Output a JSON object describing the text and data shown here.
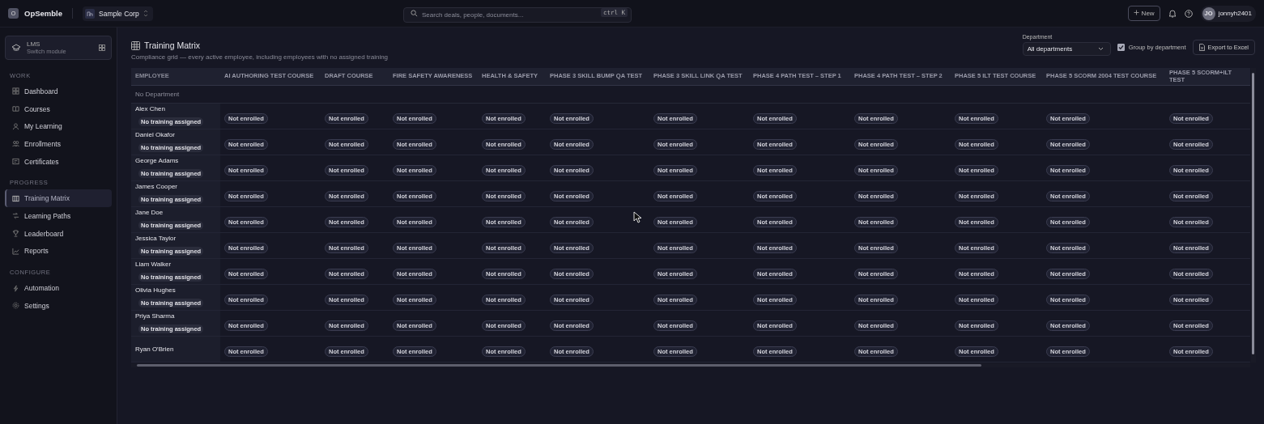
{
  "topbar": {
    "logo_letter": "O",
    "brand": "OpSemble",
    "org": "Sample Corp",
    "search": {
      "placeholder": "Search deals, people, documents...",
      "shortcut": "ctrl K"
    },
    "new_button": "New",
    "user": {
      "initials": "JO",
      "name": "jonnyh2401"
    }
  },
  "sidebar": {
    "module": {
      "name": "LMS",
      "subtitle": "Switch module"
    },
    "sections": [
      {
        "heading": "WORK",
        "items": [
          {
            "label": "Dashboard",
            "selected": false
          },
          {
            "label": "Courses",
            "selected": false
          },
          {
            "label": "My Learning",
            "selected": false
          },
          {
            "label": "Enrollments",
            "selected": false
          },
          {
            "label": "Certificates",
            "selected": false
          }
        ]
      },
      {
        "heading": "PROGRESS",
        "items": [
          {
            "label": "Training Matrix",
            "selected": true
          },
          {
            "label": "Learning Paths",
            "selected": false
          },
          {
            "label": "Leaderboard",
            "selected": false
          },
          {
            "label": "Reports",
            "selected": false
          }
        ]
      },
      {
        "heading": "CONFIGURE",
        "items": [
          {
            "label": "Automation",
            "selected": false
          },
          {
            "label": "Settings",
            "selected": false
          }
        ]
      }
    ]
  },
  "page": {
    "title": "Training Matrix",
    "subtitle": "Compliance grid — every active employee, including employees with no assigned training",
    "department": {
      "label": "Department",
      "value": "All departments"
    },
    "group_by": {
      "label": "Group by department",
      "checked": true
    },
    "export_button": "Export to Excel"
  },
  "table": {
    "columns": [
      "EMPLOYEE",
      "AI AUTHORING TEST COURSE",
      "DRAFT COURSE",
      "FIRE SAFETY AWARENESS",
      "HEALTH & SAFETY",
      "PHASE 3 SKILL BUMP QA TEST",
      "PHASE 3 SKILL LINK QA TEST",
      "PHASE 4 PATH TEST – STEP 1",
      "PHASE 4 PATH TEST – STEP 2",
      "PHASE 5 ILT TEST COURSE",
      "PHASE 5 SCORM 2004 TEST COURSE",
      "PHASE 5 SCORM+ILT TEST"
    ],
    "groups": [
      {
        "name": "No Department",
        "rows": [
          {
            "employee": "Alex Chen",
            "badge": "No training assigned",
            "cells": [
              "Not enrolled",
              "Not enrolled",
              "Not enrolled",
              "Not enrolled",
              "Not enrolled",
              "Not enrolled",
              "Not enrolled",
              "Not enrolled",
              "Not enrolled",
              "Not enrolled",
              "Not enrolled"
            ]
          },
          {
            "employee": "Daniel Okafor",
            "badge": "No training assigned",
            "cells": [
              "Not enrolled",
              "Not enrolled",
              "Not enrolled",
              "Not enrolled",
              "Not enrolled",
              "Not enrolled",
              "Not enrolled",
              "Not enrolled",
              "Not enrolled",
              "Not enrolled",
              "Not enrolled"
            ]
          },
          {
            "employee": "George Adams",
            "badge": "No training assigned",
            "cells": [
              "Not enrolled",
              "Not enrolled",
              "Not enrolled",
              "Not enrolled",
              "Not enrolled",
              "Not enrolled",
              "Not enrolled",
              "Not enrolled",
              "Not enrolled",
              "Not enrolled",
              "Not enrolled"
            ]
          },
          {
            "employee": "James Cooper",
            "badge": "No training assigned",
            "cells": [
              "Not enrolled",
              "Not enrolled",
              "Not enrolled",
              "Not enrolled",
              "Not enrolled",
              "Not enrolled",
              "Not enrolled",
              "Not enrolled",
              "Not enrolled",
              "Not enrolled",
              "Not enrolled"
            ]
          },
          {
            "employee": "Jane Doe",
            "badge": "No training assigned",
            "cells": [
              "Not enrolled",
              "Not enrolled",
              "Not enrolled",
              "Not enrolled",
              "Not enrolled",
              "Not enrolled",
              "Not enrolled",
              "Not enrolled",
              "Not enrolled",
              "Not enrolled",
              "Not enrolled"
            ]
          },
          {
            "employee": "Jessica Taylor",
            "badge": "No training assigned",
            "cells": [
              "Not enrolled",
              "Not enrolled",
              "Not enrolled",
              "Not enrolled",
              "Not enrolled",
              "Not enrolled",
              "Not enrolled",
              "Not enrolled",
              "Not enrolled",
              "Not enrolled",
              "Not enrolled"
            ]
          },
          {
            "employee": "Liam Walker",
            "badge": "No training assigned",
            "cells": [
              "Not enrolled",
              "Not enrolled",
              "Not enrolled",
              "Not enrolled",
              "Not enrolled",
              "Not enrolled",
              "Not enrolled",
              "Not enrolled",
              "Not enrolled",
              "Not enrolled",
              "Not enrolled"
            ]
          },
          {
            "employee": "Olivia Hughes",
            "badge": "No training assigned",
            "cells": [
              "Not enrolled",
              "Not enrolled",
              "Not enrolled",
              "Not enrolled",
              "Not enrolled",
              "Not enrolled",
              "Not enrolled",
              "Not enrolled",
              "Not enrolled",
              "Not enrolled",
              "Not enrolled"
            ]
          },
          {
            "employee": "Priya Sharma",
            "badge": "No training assigned",
            "cells": [
              "Not enrolled",
              "Not enrolled",
              "Not enrolled",
              "Not enrolled",
              "Not enrolled",
              "Not enrolled",
              "Not enrolled",
              "Not enrolled",
              "Not enrolled",
              "Not enrolled",
              "Not enrolled"
            ]
          },
          {
            "employee": "Ryan O'Brien",
            "cells": [
              "Not enrolled",
              "Not enrolled",
              "Not enrolled",
              "Not enrolled",
              "Not enrolled",
              "Not enrolled",
              "Not enrolled",
              "Not enrolled",
              "Not enrolled",
              "Not enrolled",
              "Not enrolled"
            ]
          }
        ]
      }
    ]
  }
}
